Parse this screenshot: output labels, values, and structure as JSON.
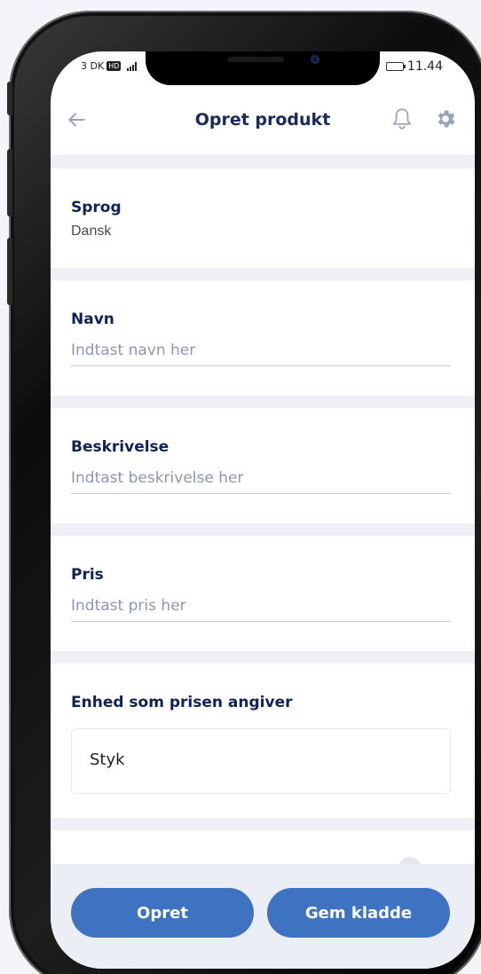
{
  "status_bar": {
    "carrier": "3 DK",
    "network_badge": "HD",
    "time": "11.44"
  },
  "header": {
    "title": "Opret produkt",
    "back_icon": "arrow-left-icon",
    "bell_icon": "bell-icon",
    "settings_icon": "gear-icon"
  },
  "form": {
    "language": {
      "label": "Sprog",
      "value": "Dansk"
    },
    "name": {
      "label": "Navn",
      "placeholder": "Indtast navn her",
      "value": ""
    },
    "description": {
      "label": "Beskrivelse",
      "placeholder": "Indtast beskrivelse her",
      "value": ""
    },
    "price": {
      "label": "Pris",
      "placeholder": "Indtast pris her",
      "value": ""
    },
    "unit": {
      "label": "Enhed som prisen angiver",
      "selected": "Styk"
    }
  },
  "actions": {
    "create_label": "Opret",
    "save_draft_label": "Gem kladde"
  },
  "colors": {
    "primary": "#3d73c1",
    "heading": "#0f2357",
    "placeholder": "#8f96ad",
    "section_gap": "#eef0f5"
  }
}
